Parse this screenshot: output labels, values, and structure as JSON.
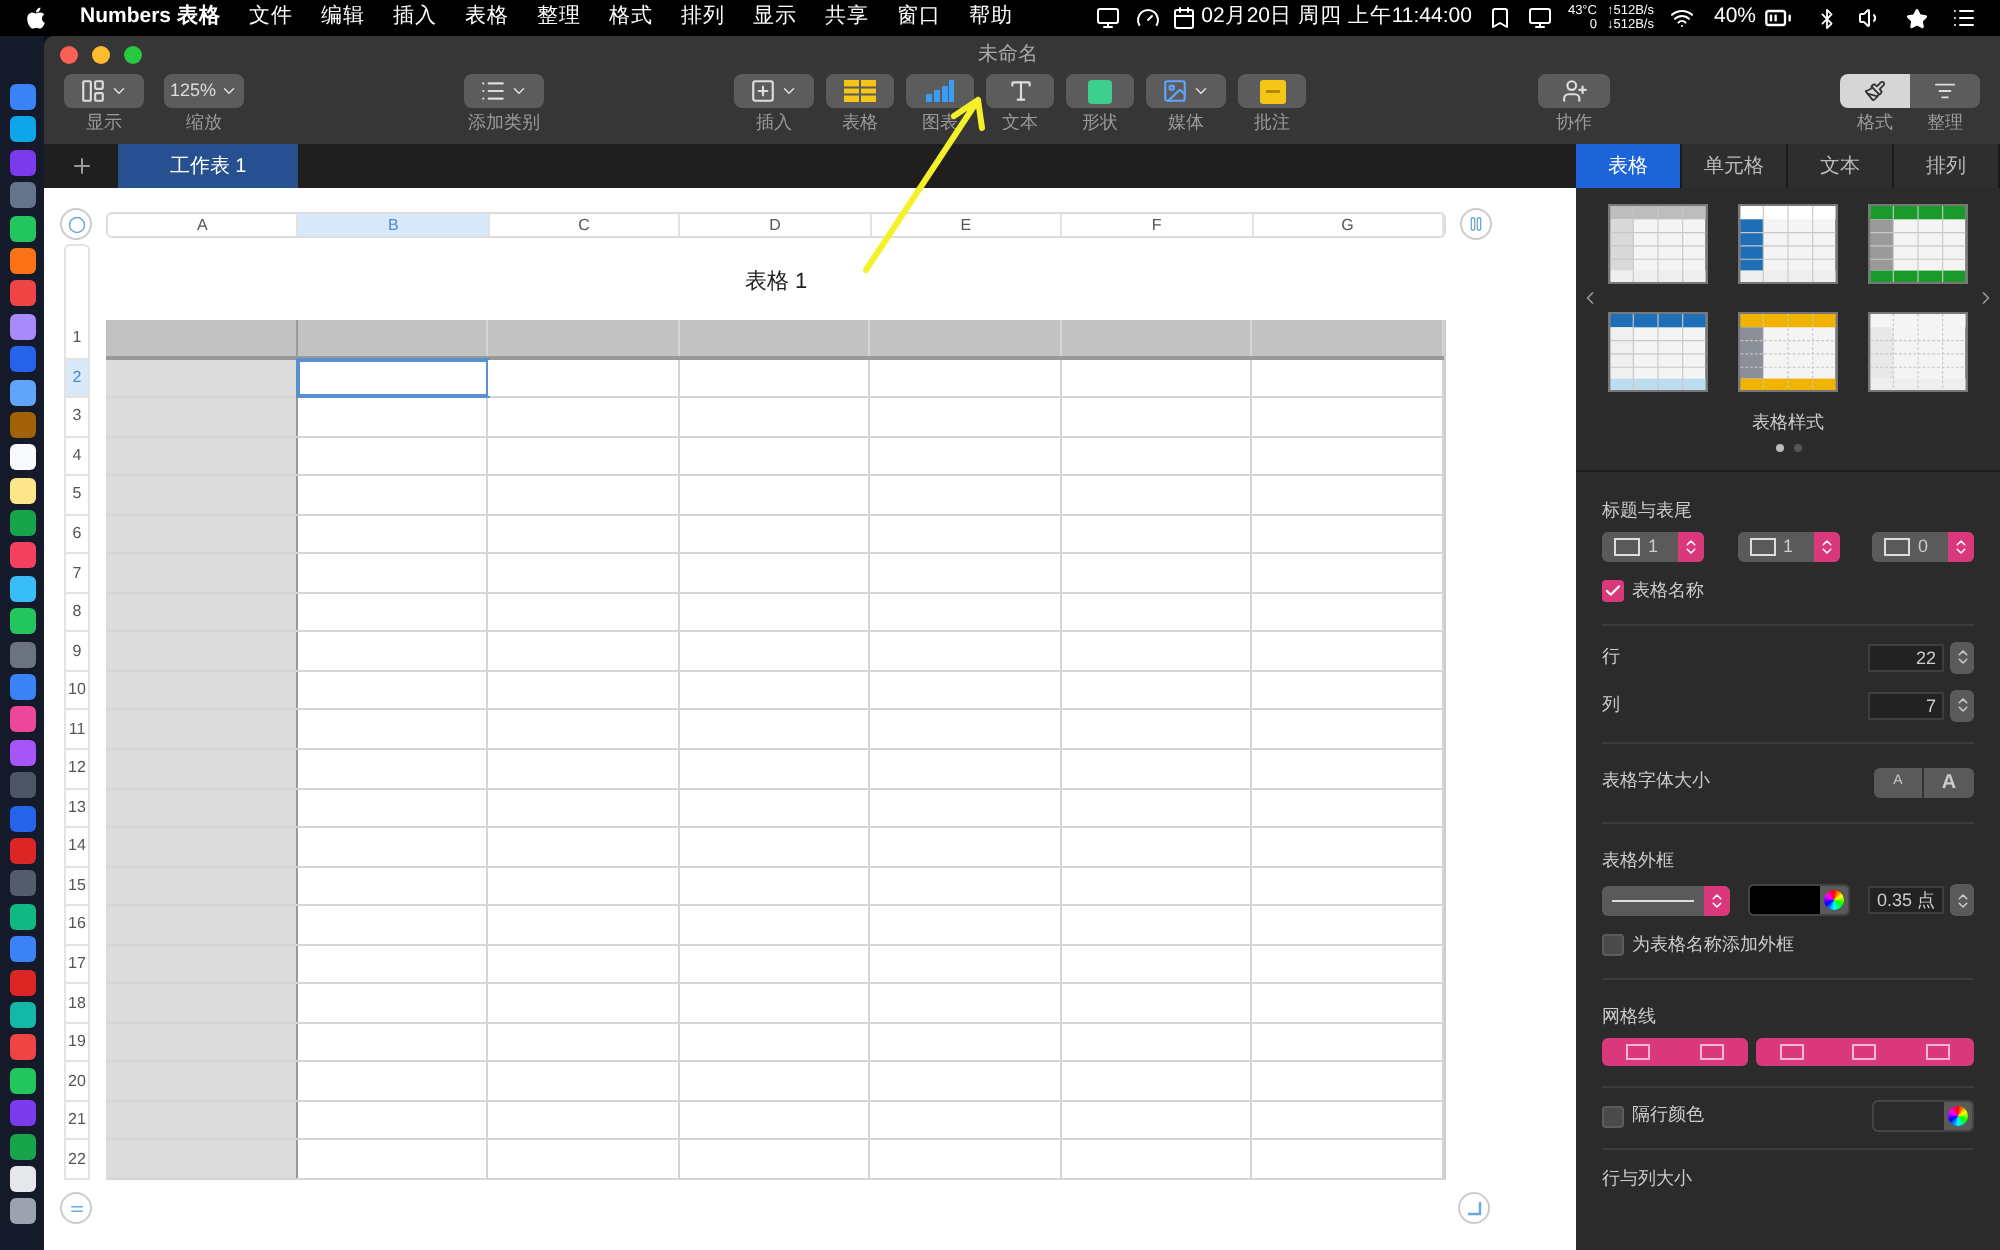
{
  "menubar": {
    "app": "Numbers 表格",
    "menus": [
      "文件",
      "编辑",
      "插入",
      "表格",
      "整理",
      "格式",
      "排列",
      "显示",
      "共享",
      "窗口",
      "帮助"
    ],
    "clock": "02月20日 周四 上午11:44:00",
    "temperature": "43°C",
    "temperature_2": "0",
    "upload": "↑512B/s",
    "download": "↓512B/s",
    "battery": "40%"
  },
  "window": {
    "title": "未命名"
  },
  "toolbar": [
    {
      "kind": "view",
      "label": "显示"
    },
    {
      "kind": "zoom",
      "value": "125%",
      "label": "缩放"
    },
    {
      "kind": "category",
      "label": "添加类别"
    },
    {
      "kind": "insert",
      "label": "插入"
    },
    {
      "kind": "table",
      "label": "表格"
    },
    {
      "kind": "chart",
      "label": "图表"
    },
    {
      "kind": "text",
      "label": "文本"
    },
    {
      "kind": "shape",
      "label": "形状"
    },
    {
      "kind": "media",
      "label": "媒体"
    },
    {
      "kind": "comment",
      "label": "批注"
    },
    {
      "kind": "collaborate",
      "label": "协作"
    }
  ],
  "inspector_toggle": [
    {
      "kind": "format",
      "label": "格式",
      "selected": true
    },
    {
      "kind": "organize",
      "label": "整理",
      "selected": false
    }
  ],
  "sheet_tabs": [
    {
      "label": "工作表 1",
      "selected": true
    }
  ],
  "table": {
    "title": "表格 1",
    "columns": [
      {
        "label": "A",
        "selected": false
      },
      {
        "label": "B",
        "selected": true
      },
      {
        "label": "C",
        "selected": false
      },
      {
        "label": "D",
        "selected": false
      },
      {
        "label": "E",
        "selected": false
      },
      {
        "label": "F",
        "selected": false
      },
      {
        "label": "G",
        "selected": false
      }
    ],
    "rows": [
      {
        "label": "1",
        "selected": false
      },
      {
        "label": "2",
        "selected": true
      },
      {
        "label": "3",
        "selected": false
      },
      {
        "label": "4",
        "selected": false
      },
      {
        "label": "5",
        "selected": false
      },
      {
        "label": "6",
        "selected": false
      },
      {
        "label": "7",
        "selected": false
      },
      {
        "label": "8",
        "selected": false
      },
      {
        "label": "9",
        "selected": false
      },
      {
        "label": "10",
        "selected": false
      },
      {
        "label": "11",
        "selected": false
      },
      {
        "label": "12",
        "selected": false
      },
      {
        "label": "13",
        "selected": false
      },
      {
        "label": "14",
        "selected": false
      },
      {
        "label": "15",
        "selected": false
      },
      {
        "label": "16",
        "selected": false
      },
      {
        "label": "17",
        "selected": false
      },
      {
        "label": "18",
        "selected": false
      },
      {
        "label": "19",
        "selected": false
      },
      {
        "label": "20",
        "selected": false
      },
      {
        "label": "21",
        "selected": false
      },
      {
        "label": "22",
        "selected": false
      }
    ]
  },
  "inspector": {
    "tabs": [
      {
        "label": "表格",
        "selected": true
      },
      {
        "label": "单元格",
        "selected": false
      },
      {
        "label": "文本",
        "selected": false
      },
      {
        "label": "排列",
        "selected": false
      }
    ],
    "styles_title": "表格样式",
    "style_pages": [
      {
        "selected": true
      },
      {
        "selected": false
      }
    ],
    "header_footer": {
      "title": "标题与表尾",
      "steppers": [
        "1",
        "1",
        "0"
      ]
    },
    "table_name": {
      "label": "表格名称",
      "checked": true
    },
    "row_count": {
      "label": "行",
      "value": "22"
    },
    "column_count": {
      "label": "列",
      "value": "7"
    },
    "font_size": {
      "label": "表格字体大小",
      "smaller": "A",
      "larger": "A"
    },
    "border": {
      "title": "表格外框",
      "width": "0.35 点"
    },
    "name_border": {
      "label": "为表格名称添加外框",
      "checked": false
    },
    "gridlines": {
      "title": "网格线"
    },
    "alternating_rows": {
      "label": "隔行颜色",
      "checked": false
    },
    "size_title": "行与列大小"
  }
}
